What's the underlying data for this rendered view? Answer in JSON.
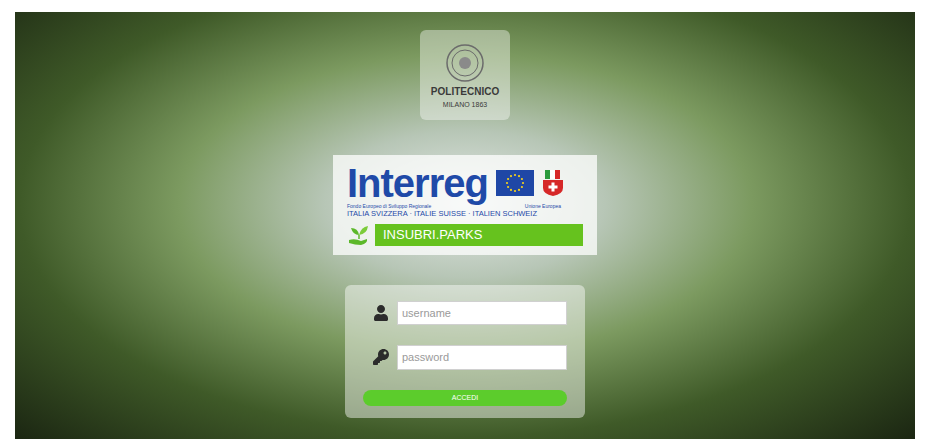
{
  "logo": {
    "name": "POLITECNICO",
    "subtitle": "MILANO 1863"
  },
  "banner": {
    "title": "Interreg",
    "fund": "Fondo Europeo di Sviluppo Regionale",
    "union": "Unione Europea",
    "countries": "ITALIA SVIZZERA · ITALIE SUISSE · ITALIEN SCHWEIZ",
    "project": "INSUBRI.PARKS"
  },
  "form": {
    "fields": [
      {
        "placeholder": "username",
        "kind": "text"
      },
      {
        "placeholder": "password",
        "kind": "password"
      }
    ],
    "button": "ACCEDI"
  }
}
